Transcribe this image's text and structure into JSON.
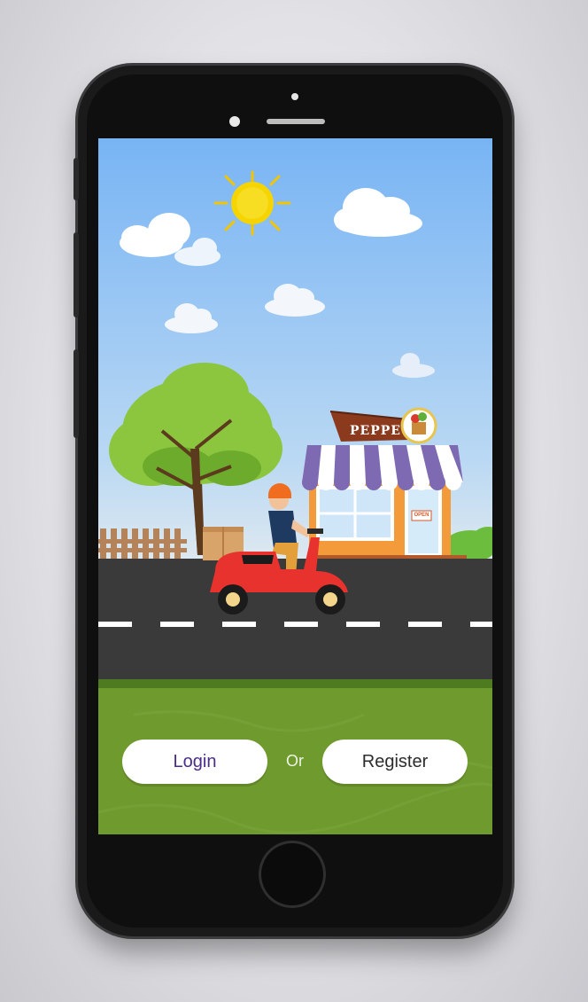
{
  "shop": {
    "sign_text": "PEPPE",
    "door_sign": "OPEN"
  },
  "auth": {
    "login_label": "Login",
    "or_label": "Or",
    "register_label": "Register"
  },
  "colors": {
    "sky": "#7fb8f5",
    "grass": "#6f9a2e",
    "road": "#3a3a3a",
    "scooter": "#e8322e",
    "awning": "#7d6ab3"
  }
}
